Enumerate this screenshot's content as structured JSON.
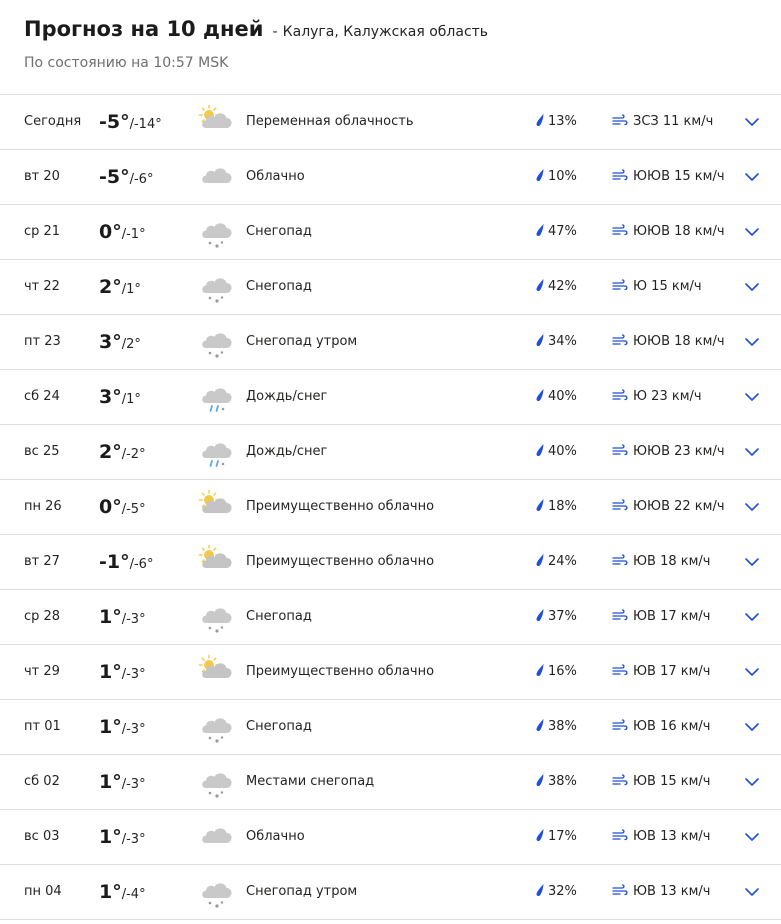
{
  "header": {
    "title": "Прогноз на 10 дней",
    "separator": "-",
    "location": "Калуга, Калужская область",
    "as_of": "По состоянию на 10:57 MSK"
  },
  "colors": {
    "accent": "#1f4fd6",
    "divider": "#dedede",
    "cloud": "#c9c9c9",
    "sun": "#f2c94c",
    "rain": "#5aa9e6"
  },
  "days": [
    {
      "day": "Сегодня",
      "hi": "-5°",
      "lo": "/-14°",
      "icon": "partly-cloudy-icon",
      "phrase": "Переменная облачность",
      "precip": "13%",
      "wind": "ЗСЗ 11 км/ч"
    },
    {
      "day": "вт 20",
      "hi": "-5°",
      "lo": "/-6°",
      "icon": "cloudy-icon",
      "phrase": "Облачно",
      "precip": "10%",
      "wind": "ЮЮВ 15 км/ч"
    },
    {
      "day": "ср 21",
      "hi": "0°",
      "lo": "/-1°",
      "icon": "snow-icon",
      "phrase": "Снегопад",
      "precip": "47%",
      "wind": "ЮЮВ 18 км/ч"
    },
    {
      "day": "чт 22",
      "hi": "2°",
      "lo": "/1°",
      "icon": "snow-icon",
      "phrase": "Снегопад",
      "precip": "42%",
      "wind": "Ю 15 км/ч"
    },
    {
      "day": "пт 23",
      "hi": "3°",
      "lo": "/2°",
      "icon": "snow-icon",
      "phrase": "Снегопад утром",
      "precip": "34%",
      "wind": "ЮЮВ 18 км/ч"
    },
    {
      "day": "сб 24",
      "hi": "3°",
      "lo": "/1°",
      "icon": "rain-snow-icon",
      "phrase": "Дождь/снег",
      "precip": "40%",
      "wind": "Ю 23 км/ч"
    },
    {
      "day": "вс 25",
      "hi": "2°",
      "lo": "/-2°",
      "icon": "rain-snow-icon",
      "phrase": "Дождь/снег",
      "precip": "40%",
      "wind": "ЮЮВ 23 км/ч"
    },
    {
      "day": "пн 26",
      "hi": "0°",
      "lo": "/-5°",
      "icon": "mostly-cloudy-icon",
      "phrase": "Преимущественно облачно",
      "precip": "18%",
      "wind": "ЮЮВ 22 км/ч"
    },
    {
      "day": "вт 27",
      "hi": "-1°",
      "lo": "/-6°",
      "icon": "mostly-cloudy-icon",
      "phrase": "Преимущественно облачно",
      "precip": "24%",
      "wind": "ЮВ 18 км/ч"
    },
    {
      "day": "ср 28",
      "hi": "1°",
      "lo": "/-3°",
      "icon": "snow-icon",
      "phrase": "Снегопад",
      "precip": "37%",
      "wind": "ЮВ 17 км/ч"
    },
    {
      "day": "чт 29",
      "hi": "1°",
      "lo": "/-3°",
      "icon": "mostly-cloudy-icon",
      "phrase": "Преимущественно облачно",
      "precip": "16%",
      "wind": "ЮВ 17 км/ч"
    },
    {
      "day": "пт 01",
      "hi": "1°",
      "lo": "/-3°",
      "icon": "snow-icon",
      "phrase": "Снегопад",
      "precip": "38%",
      "wind": "ЮВ 16 км/ч"
    },
    {
      "day": "сб 02",
      "hi": "1°",
      "lo": "/-3°",
      "icon": "snow-icon",
      "phrase": "Местами снегопад",
      "precip": "38%",
      "wind": "ЮВ 15 км/ч"
    },
    {
      "day": "вс 03",
      "hi": "1°",
      "lo": "/-3°",
      "icon": "cloudy-icon",
      "phrase": "Облачно",
      "precip": "17%",
      "wind": "ЮВ 13 км/ч"
    },
    {
      "day": "пн 04",
      "hi": "1°",
      "lo": "/-4°",
      "icon": "snow-icon",
      "phrase": "Снегопад утром",
      "precip": "32%",
      "wind": "ЮВ 13 км/ч"
    }
  ]
}
